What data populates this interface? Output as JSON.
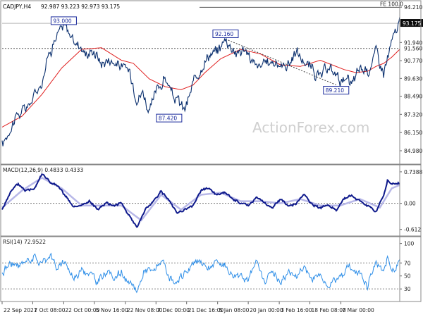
{
  "header": {
    "symbol": "CADJPY,H4",
    "ohlc": "92.987 93.223 92.973 93.175"
  },
  "watermark": "ActionForex.com",
  "colors": {
    "price": "#0a2f6e",
    "ma": "#e02020",
    "macd": "#0f1a8c",
    "macd_signal": "#b8b8e8",
    "rsi": "#2f8fe8",
    "grid": "#999999",
    "label_box": "#1a2a9c"
  },
  "chart_data": [
    {
      "type": "line",
      "title": "CADJPY,H4",
      "ylim": [
        84.3,
        94.4
      ],
      "y_ticks": [
        "94.210",
        "91.940",
        "90.770",
        "89.630",
        "88.490",
        "87.320",
        "86.150",
        "84.980"
      ],
      "x_ticks": [
        "22 Sep 2021",
        "7 Oct 08:00",
        "22 Oct 00:00",
        "5 Nov 16:00",
        "22 Nov 08:00",
        "7 Dec 00:00",
        "21 Dec 16:00",
        "5 Jan 08:00",
        "20 Jan 00:00",
        "3 Feb 16:00",
        "18 Feb 08:00",
        "7 Mar 00:00"
      ],
      "x_tick_t": [
        0,
        0.077,
        0.155,
        0.232,
        0.31,
        0.387,
        0.464,
        0.542,
        0.619,
        0.697,
        0.774,
        0.852
      ],
      "series": [
        {
          "role": "price",
          "t": [
            0.0,
            0.03,
            0.07,
            0.1,
            0.12,
            0.145,
            0.16,
            0.18,
            0.2,
            0.215,
            0.23,
            0.25,
            0.27,
            0.3,
            0.32,
            0.34,
            0.355,
            0.37,
            0.39,
            0.41,
            0.425,
            0.44,
            0.46,
            0.48,
            0.5,
            0.52,
            0.54,
            0.56,
            0.575,
            0.59,
            0.61,
            0.64,
            0.66,
            0.68,
            0.7,
            0.72,
            0.74,
            0.76,
            0.78,
            0.8,
            0.82,
            0.84,
            0.86,
            0.88,
            0.9,
            0.92,
            0.94,
            0.96,
            0.97,
            0.985,
            1.0
          ],
          "values": [
            85.3,
            87.0,
            88.0,
            89.5,
            91.5,
            92.7,
            93.0,
            92.0,
            91.7,
            91.1,
            91.5,
            90.6,
            90.9,
            90.4,
            90.1,
            88.4,
            88.8,
            87.4,
            88.9,
            89.7,
            88.7,
            88.2,
            87.6,
            89.2,
            90.4,
            91.2,
            91.3,
            92.16,
            91.8,
            91.3,
            91.5,
            90.3,
            90.5,
            90.8,
            90.4,
            90.6,
            91.3,
            90.7,
            90.2,
            89.6,
            90.3,
            89.9,
            89.4,
            89.21,
            90.3,
            90.1,
            91.4,
            90.0,
            91.0,
            92.3,
            93.175
          ]
        },
        {
          "role": "moving average",
          "t": [
            0.0,
            0.05,
            0.1,
            0.15,
            0.2,
            0.25,
            0.3,
            0.33,
            0.37,
            0.41,
            0.45,
            0.48,
            0.51,
            0.55,
            0.6,
            0.65,
            0.7,
            0.75,
            0.8,
            0.83,
            0.86,
            0.89,
            0.92,
            0.94,
            0.96,
            0.98,
            1.0
          ],
          "values": [
            86.5,
            87.2,
            88.6,
            90.3,
            91.5,
            91.6,
            90.8,
            90.6,
            89.6,
            89.1,
            88.9,
            89.2,
            90.0,
            90.9,
            91.5,
            91.2,
            90.5,
            90.4,
            90.8,
            90.5,
            90.2,
            90.0,
            90.1,
            90.4,
            90.6,
            91.0,
            91.5
          ]
        }
      ],
      "annotations": [
        {
          "text": "93.000",
          "t": 0.155,
          "value": 93.0
        },
        {
          "text": "92.160",
          "t": 0.562,
          "value": 92.16
        },
        {
          "text": "87.420",
          "t": 0.42,
          "value": 87.42
        },
        {
          "text": "89.210",
          "t": 0.84,
          "value": 89.21
        },
        {
          "text": "FE 100.0",
          "t": 0.96,
          "value": 94.2
        }
      ],
      "hlines": [
        {
          "value": 93.175,
          "label": "93.175",
          "style": "dark box"
        },
        {
          "value": 91.56,
          "label": "91.560",
          "style": "dotted"
        },
        {
          "value": 94.2,
          "label": "FE 100.0",
          "style": "solid"
        }
      ],
      "trendline": {
        "from": {
          "t": 0.562,
          "value": 92.16
        },
        "to": {
          "t": 0.84,
          "value": 89.21
        }
      }
    },
    {
      "type": "line",
      "title": "MACD(12,26,9) 0.4833 0.4333",
      "ylim": [
        -0.7,
        0.82
      ],
      "y_ticks": [
        "0.7388",
        "0.00",
        "-0.612"
      ],
      "series": [
        {
          "role": "macd",
          "t": [
            0.0,
            0.02,
            0.04,
            0.06,
            0.08,
            0.1,
            0.12,
            0.14,
            0.16,
            0.18,
            0.2,
            0.22,
            0.24,
            0.26,
            0.28,
            0.3,
            0.32,
            0.34,
            0.36,
            0.38,
            0.4,
            0.42,
            0.44,
            0.46,
            0.48,
            0.5,
            0.52,
            0.54,
            0.56,
            0.58,
            0.6,
            0.62,
            0.64,
            0.66,
            0.68,
            0.7,
            0.72,
            0.74,
            0.76,
            0.78,
            0.8,
            0.82,
            0.84,
            0.86,
            0.88,
            0.9,
            0.92,
            0.94,
            0.96,
            0.97,
            0.98,
            1.0
          ],
          "values": [
            -0.15,
            0.25,
            0.45,
            0.3,
            0.35,
            0.7,
            0.5,
            0.4,
            0.15,
            -0.1,
            -0.05,
            0.05,
            -0.15,
            0.0,
            -0.05,
            0.0,
            -0.3,
            -0.55,
            -0.15,
            0.05,
            0.3,
            0.05,
            -0.2,
            -0.15,
            -0.05,
            0.3,
            0.35,
            0.2,
            0.25,
            0.1,
            0.0,
            -0.05,
            0.15,
            0.0,
            -0.1,
            0.1,
            -0.05,
            0.0,
            0.2,
            -0.05,
            -0.1,
            -0.05,
            -0.15,
            0.1,
            0.2,
            0.05,
            -0.05,
            -0.2,
            0.2,
            0.55,
            0.45,
            0.48
          ]
        },
        {
          "role": "signal",
          "t": [
            0.0,
            0.05,
            0.1,
            0.15,
            0.2,
            0.25,
            0.3,
            0.35,
            0.4,
            0.45,
            0.5,
            0.55,
            0.6,
            0.65,
            0.7,
            0.75,
            0.8,
            0.85,
            0.9,
            0.95,
            0.98,
            1.0
          ],
          "values": [
            -0.1,
            0.3,
            0.6,
            0.35,
            -0.05,
            -0.05,
            -0.05,
            -0.4,
            0.2,
            -0.15,
            0.2,
            0.25,
            0.05,
            0.05,
            0.0,
            0.1,
            -0.05,
            -0.05,
            0.1,
            -0.1,
            0.35,
            0.43
          ]
        }
      ]
    },
    {
      "type": "line",
      "title": "RSI(14) 72.9522",
      "ylim": [
        15,
        105
      ],
      "y_ticks": [
        "100",
        "70",
        "50",
        "30"
      ],
      "hlines": [
        70,
        30
      ],
      "series": [
        {
          "role": "rsi",
          "t": [
            0.0,
            0.02,
            0.04,
            0.06,
            0.08,
            0.1,
            0.12,
            0.14,
            0.16,
            0.18,
            0.2,
            0.22,
            0.24,
            0.26,
            0.28,
            0.3,
            0.32,
            0.34,
            0.36,
            0.38,
            0.4,
            0.42,
            0.44,
            0.46,
            0.48,
            0.5,
            0.52,
            0.54,
            0.56,
            0.58,
            0.6,
            0.62,
            0.64,
            0.66,
            0.68,
            0.7,
            0.72,
            0.74,
            0.76,
            0.78,
            0.8,
            0.82,
            0.84,
            0.86,
            0.88,
            0.9,
            0.92,
            0.94,
            0.96,
            0.97,
            0.98,
            1.0
          ],
          "values": [
            55,
            70,
            62,
            75,
            80,
            68,
            85,
            60,
            72,
            45,
            62,
            55,
            40,
            58,
            48,
            55,
            35,
            28,
            62,
            55,
            75,
            45,
            35,
            55,
            68,
            75,
            60,
            72,
            68,
            50,
            55,
            45,
            70,
            42,
            60,
            38,
            58,
            48,
            65,
            45,
            52,
            38,
            45,
            58,
            62,
            55,
            38,
            68,
            55,
            78,
            60,
            73
          ]
        }
      ]
    }
  ]
}
